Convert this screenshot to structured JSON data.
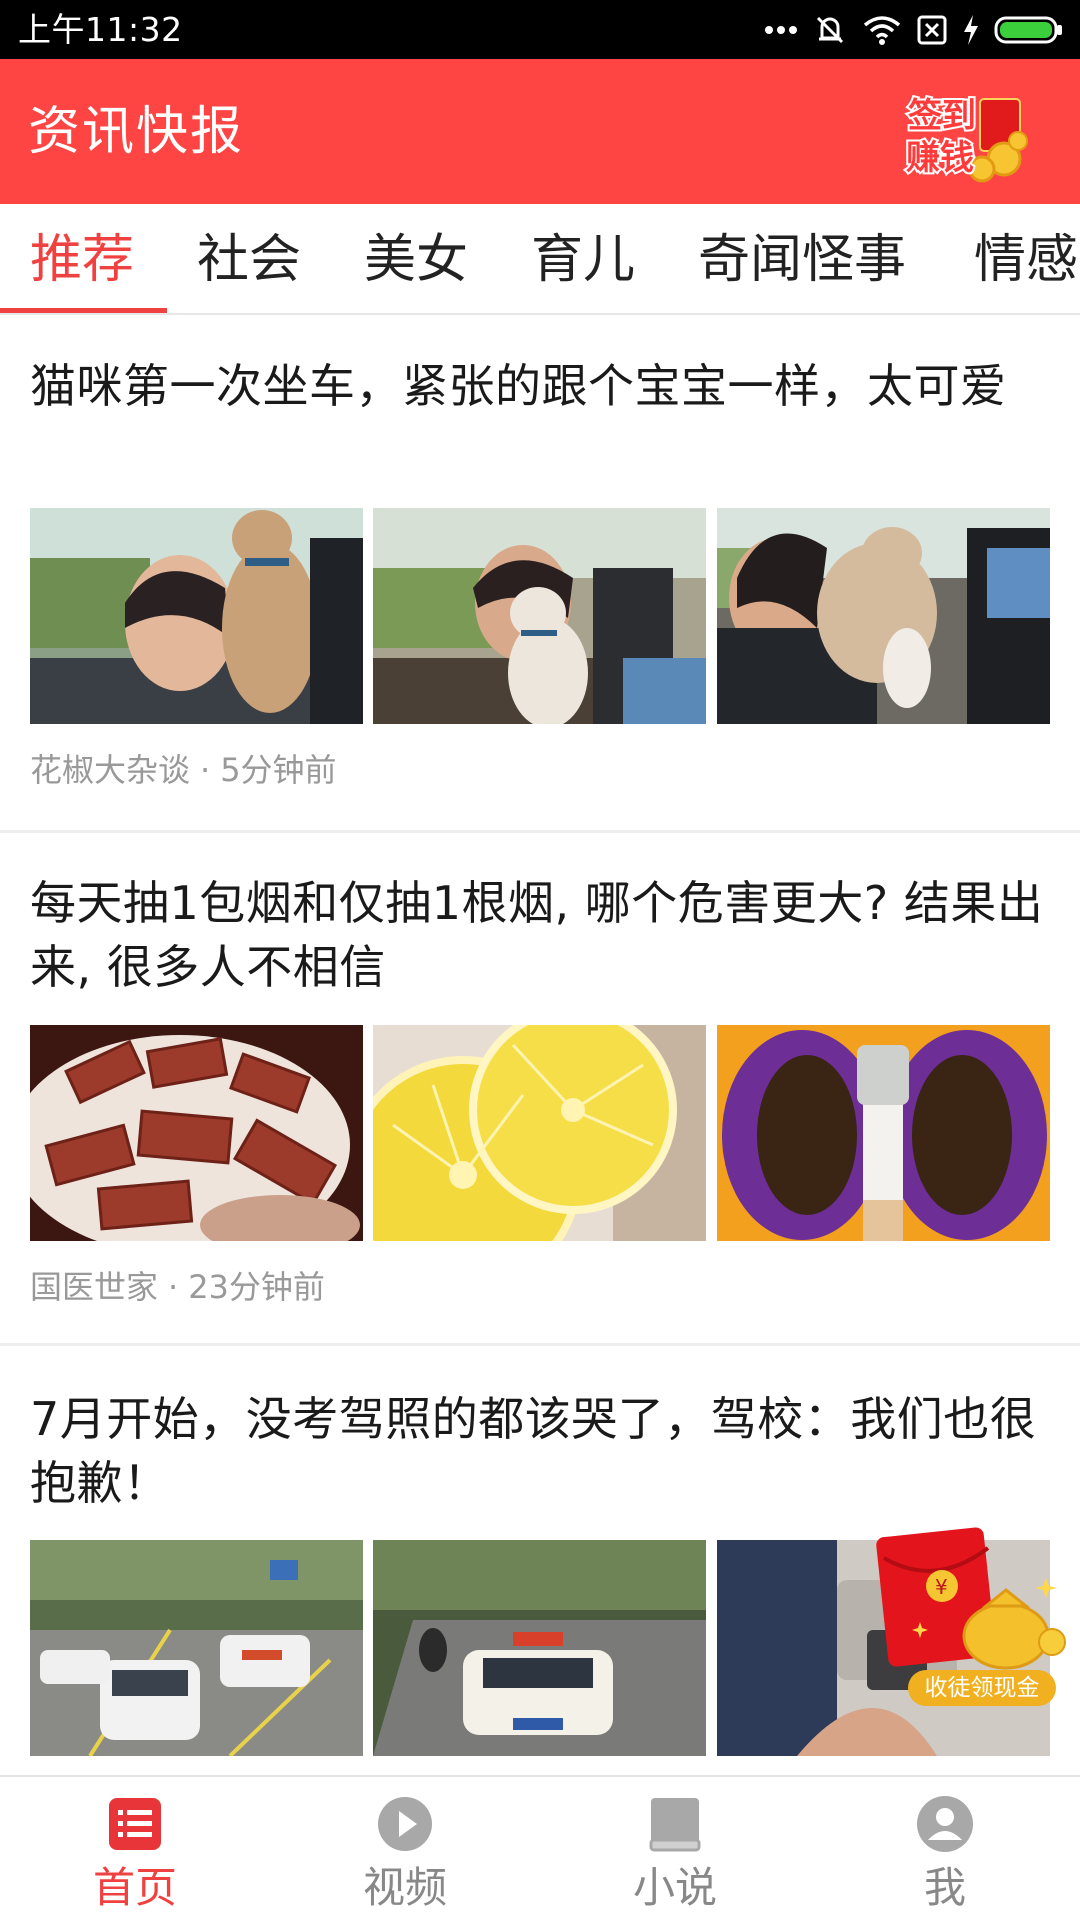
{
  "status_bar": {
    "time": "上午11:32"
  },
  "header": {
    "title": "资讯快报",
    "signin_badge": {
      "line1": "签到",
      "line2": "赚钱"
    }
  },
  "tabs": [
    {
      "label": "推荐",
      "active": true
    },
    {
      "label": "社会",
      "active": false
    },
    {
      "label": "美女",
      "active": false
    },
    {
      "label": "育儿",
      "active": false
    },
    {
      "label": "奇闻怪事",
      "active": false
    },
    {
      "label": "情感",
      "active": false
    }
  ],
  "articles": [
    {
      "title": "猫咪第一次坐车，紧张的跟个宝宝一样，太可爱",
      "source": "花椒大杂谈",
      "separator": "·",
      "time": "5分钟前"
    },
    {
      "title": "每天抽1包烟和仅抽1根烟, 哪个危害更大? 结果出来, 很多人不相信",
      "source": "国医世家",
      "separator": "·",
      "time": "23分钟前"
    },
    {
      "title": "7月开始，没考驾照的都该哭了，驾校：我们也很抱歉！"
    }
  ],
  "float_envelope": {
    "label": "收徒领现金"
  },
  "bottom_nav": [
    {
      "label": "首页",
      "icon": "home-list-icon",
      "active": true
    },
    {
      "label": "视频",
      "icon": "play-circle-icon",
      "active": false
    },
    {
      "label": "小说",
      "icon": "book-icon",
      "active": false
    },
    {
      "label": "我",
      "icon": "user-avatar-icon",
      "active": false
    }
  ],
  "colors": {
    "brand_red": "#ff4444",
    "tab_active": "#f04141",
    "meta_gray": "#999999"
  }
}
